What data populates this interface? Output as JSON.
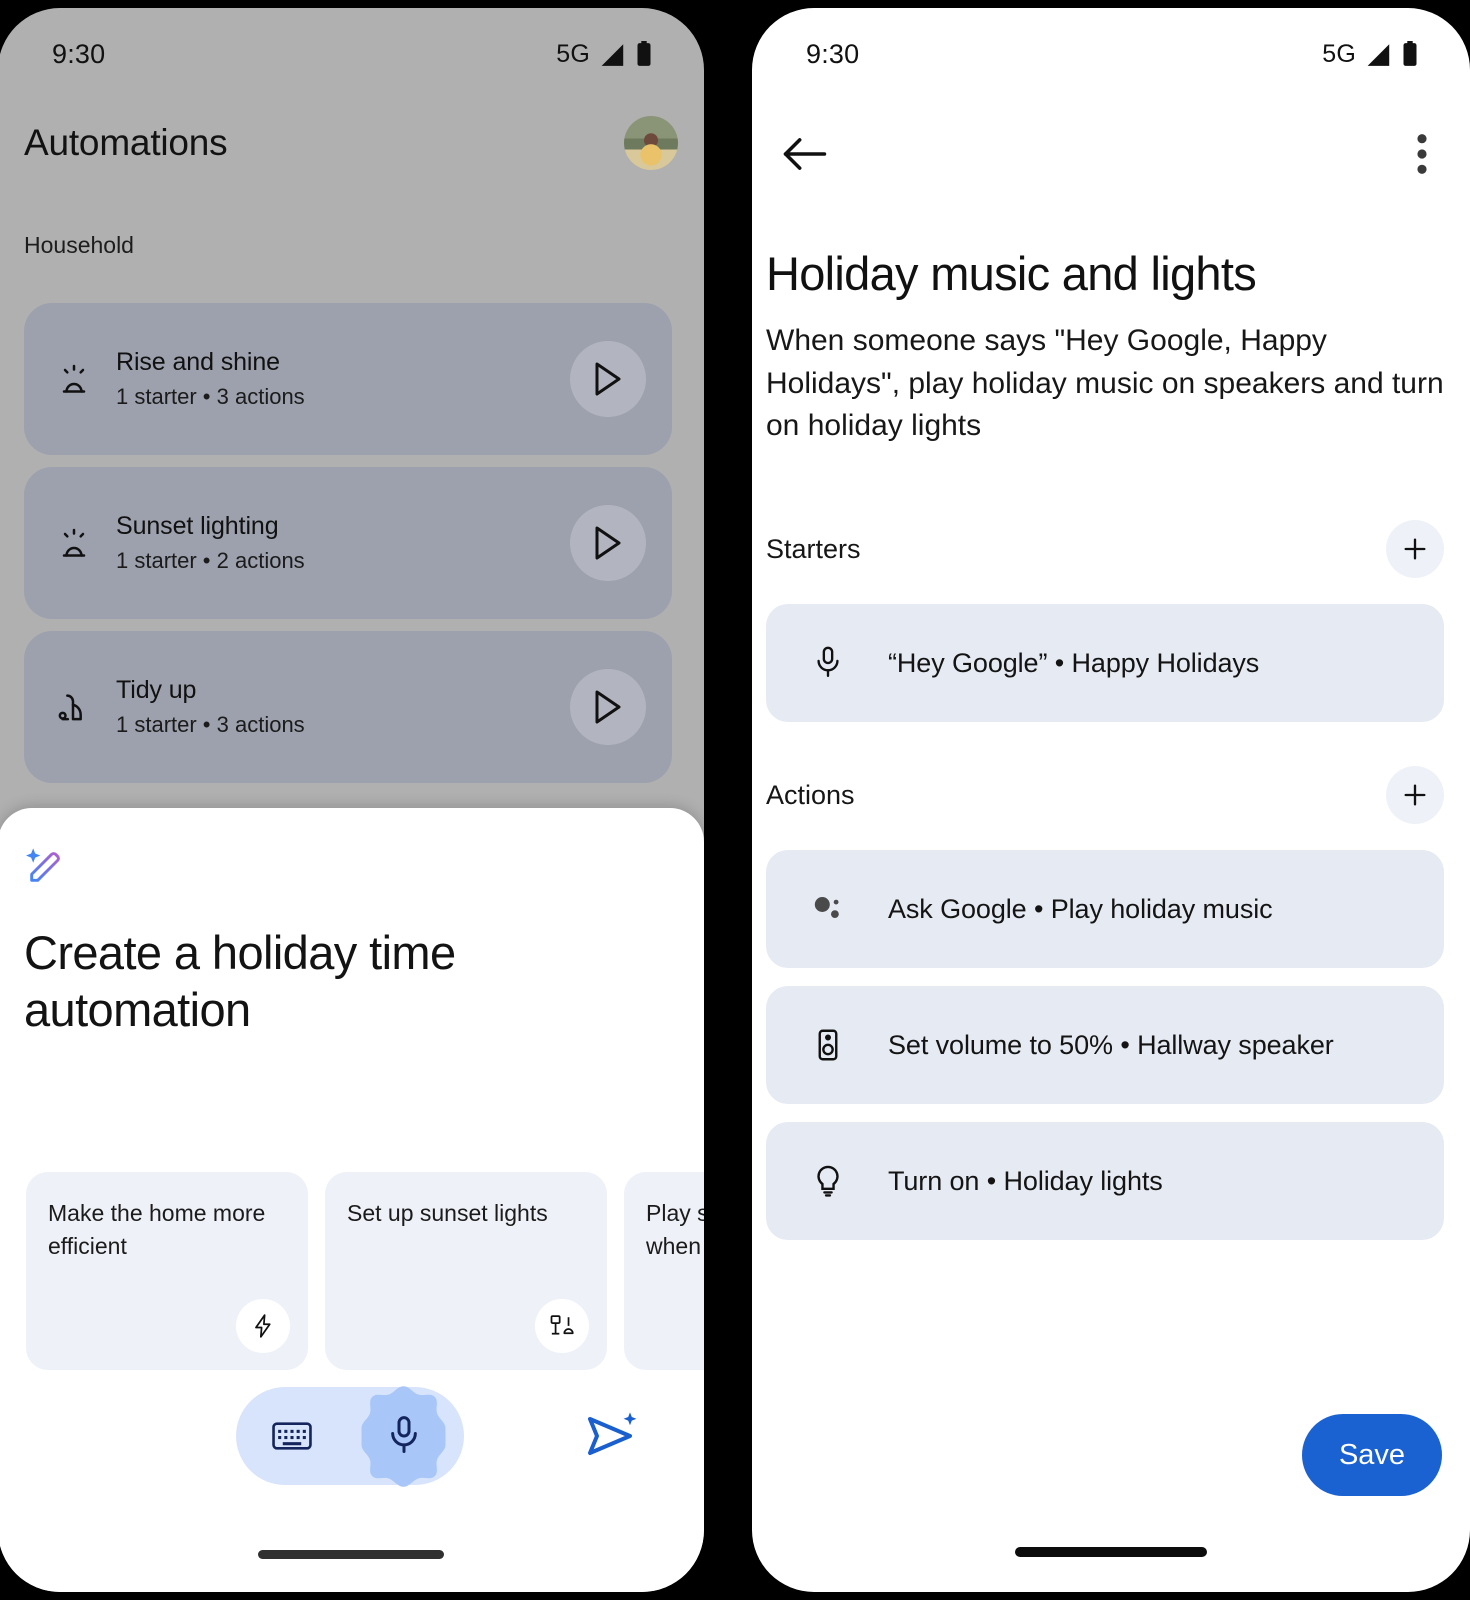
{
  "status_bar": {
    "time": "9:30",
    "network": "5G",
    "signal_icon": "signal-bars-icon",
    "battery_icon": "battery-full-icon"
  },
  "left_screen": {
    "title": "Automations",
    "avatar_icon": "user-avatar",
    "section_label": "Household",
    "automations": [
      {
        "name": "Rise and shine",
        "meta": "1 starter • 3 actions",
        "icon": "sunrise-icon",
        "play_icon": "play-icon"
      },
      {
        "name": "Sunset lighting",
        "meta": "1 starter • 2 actions",
        "icon": "sunrise-icon",
        "play_icon": "play-icon"
      },
      {
        "name": "Tidy up",
        "meta": "1 starter • 3 actions",
        "icon": "vacuum-robot-icon",
        "play_icon": "play-icon"
      }
    ],
    "sheet": {
      "sparkle_icon": "magic-pencil-icon",
      "title": "Create a holiday time automation",
      "suggestions": [
        {
          "text": "Make the home more efficient",
          "icon": "bolt-icon"
        },
        {
          "text": "Set up sunset lights",
          "icon": "lamp-icon"
        },
        {
          "text": "Play s\nwhen",
          "icon": ""
        }
      ],
      "input_bar": {
        "keyboard_icon": "keyboard-icon",
        "mic_icon": "microphone-icon",
        "send_icon": "send-sparkle-icon"
      }
    }
  },
  "right_screen": {
    "back_icon": "back-arrow-icon",
    "overflow_icon": "more-vertical-icon",
    "title": "Holiday music and lights",
    "description": "When someone says \"Hey Google, Happy Holidays\", play holiday music on speakers and turn on holiday lights",
    "starters": {
      "label": "Starters",
      "add_icon": "plus-icon",
      "items": [
        {
          "text": "“Hey Google” • Happy Holidays",
          "icon": "microphone-icon"
        }
      ]
    },
    "actions": {
      "label": "Actions",
      "add_icon": "plus-icon",
      "items": [
        {
          "text": "Ask Google • Play holiday music",
          "icon": "google-assistant-icon"
        },
        {
          "text": "Set volume to 50% • Hallway speaker",
          "icon": "speaker-icon"
        },
        {
          "text": "Turn on • Holiday lights",
          "icon": "lightbulb-icon"
        }
      ]
    },
    "save_label": "Save"
  },
  "colors": {
    "accent_blue": "#1a62d1",
    "card_blue": "#e6eaf2",
    "chip_blue": "#eef1f7",
    "scrim": "#b0b0b0",
    "dim_card": "#9da1ad"
  }
}
